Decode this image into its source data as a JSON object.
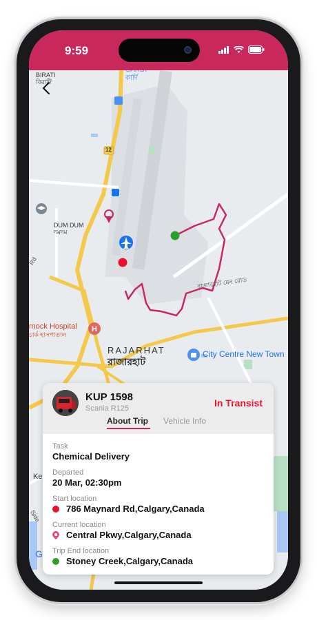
{
  "status_bar": {
    "time": "9:59"
  },
  "map": {
    "labels": {
      "birati_en": "BIRATI",
      "birati_bn": "বিরাটি",
      "cardi_en": "CARDI",
      "cardi_bn": "কার্দি",
      "road_badge": "12",
      "dumdum_en": "DUM DUM",
      "dumdum_bn": "দমদম",
      "rd": "Rd",
      "rajarhat_road": "রাজারহাট মেন রোড",
      "hospital_en": "rnock Hospital",
      "hospital_bn": "চার্ক হাসপাতাল",
      "rajarhat_en": "RAJARHAT",
      "rajarhat_bn": "রাজারহাট",
      "city_centre": "City Centre New Town",
      "ke": "Ke",
      "side": "Side"
    },
    "route_color": "#c9285c",
    "start_marker_color": "#e8142b",
    "end_marker_color": "#2ca02c"
  },
  "card": {
    "vehicle_number": "KUP 1598",
    "vehicle_model": "Scania R125",
    "status": "In Transist",
    "tabs": [
      "About Trip",
      "Vehicle Info"
    ],
    "fields": {
      "task_label": "Task",
      "task_value": "Chemical Delivery",
      "departed_label": "Departed",
      "departed_value": "20 Mar, 02:30pm",
      "start_label": "Start location",
      "start_value": "786 Maynard Rd,Calgary,Canada",
      "current_label": "Current location",
      "current_value": "Central Pkwy,Calgary,Canada",
      "end_label": "Trip End location",
      "end_value": "Stoney Creek,Calgary,Canada"
    }
  }
}
